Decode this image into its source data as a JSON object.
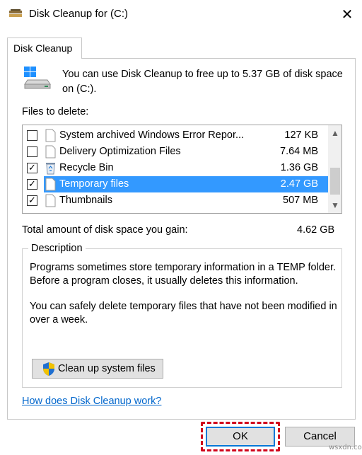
{
  "window": {
    "title": "Disk Cleanup for  (C:)",
    "close_glyph": "✕",
    "app_icon": "disk-cleanup-icon"
  },
  "tab": {
    "label": "Disk Cleanup"
  },
  "info": {
    "icon": "drive-icon",
    "text": "You can use Disk Cleanup to free up to 5.37 GB of disk space on  (C:)."
  },
  "files_label": "Files to delete:",
  "files": [
    {
      "name": "System archived Windows Error Repor...",
      "size": "127 KB",
      "checked": false,
      "selected": false,
      "icon": "file-icon"
    },
    {
      "name": "Delivery Optimization Files",
      "size": "7.64 MB",
      "checked": false,
      "selected": false,
      "icon": "file-icon"
    },
    {
      "name": "Recycle Bin",
      "size": "1.36 GB",
      "checked": true,
      "selected": false,
      "icon": "recycle-bin-icon"
    },
    {
      "name": "Temporary files",
      "size": "2.47 GB",
      "checked": true,
      "selected": true,
      "icon": "file-icon"
    },
    {
      "name": "Thumbnails",
      "size": "507 MB",
      "checked": true,
      "selected": false,
      "icon": "file-icon"
    }
  ],
  "scroll": {
    "up_glyph": "▲",
    "down_glyph": "▼"
  },
  "total": {
    "label": "Total amount of disk space you gain:",
    "value": "4.62 GB"
  },
  "description": {
    "legend": "Description",
    "paragraph1": "Programs sometimes store temporary information in a TEMP folder. Before a program closes, it usually deletes this information.",
    "paragraph2": "You can safely delete temporary files that have not been modified in over a week."
  },
  "cleanup_button": {
    "label": "Clean up system files",
    "icon": "shield-icon"
  },
  "help_link": "How does Disk Cleanup work?",
  "buttons": {
    "ok": "OK",
    "cancel": "Cancel"
  },
  "watermark": "wsxdn.com",
  "colors": {
    "selection": "#3399ff",
    "link": "#0066cc",
    "highlight_outline": "#d0021b",
    "focus_border": "#0078d7"
  }
}
